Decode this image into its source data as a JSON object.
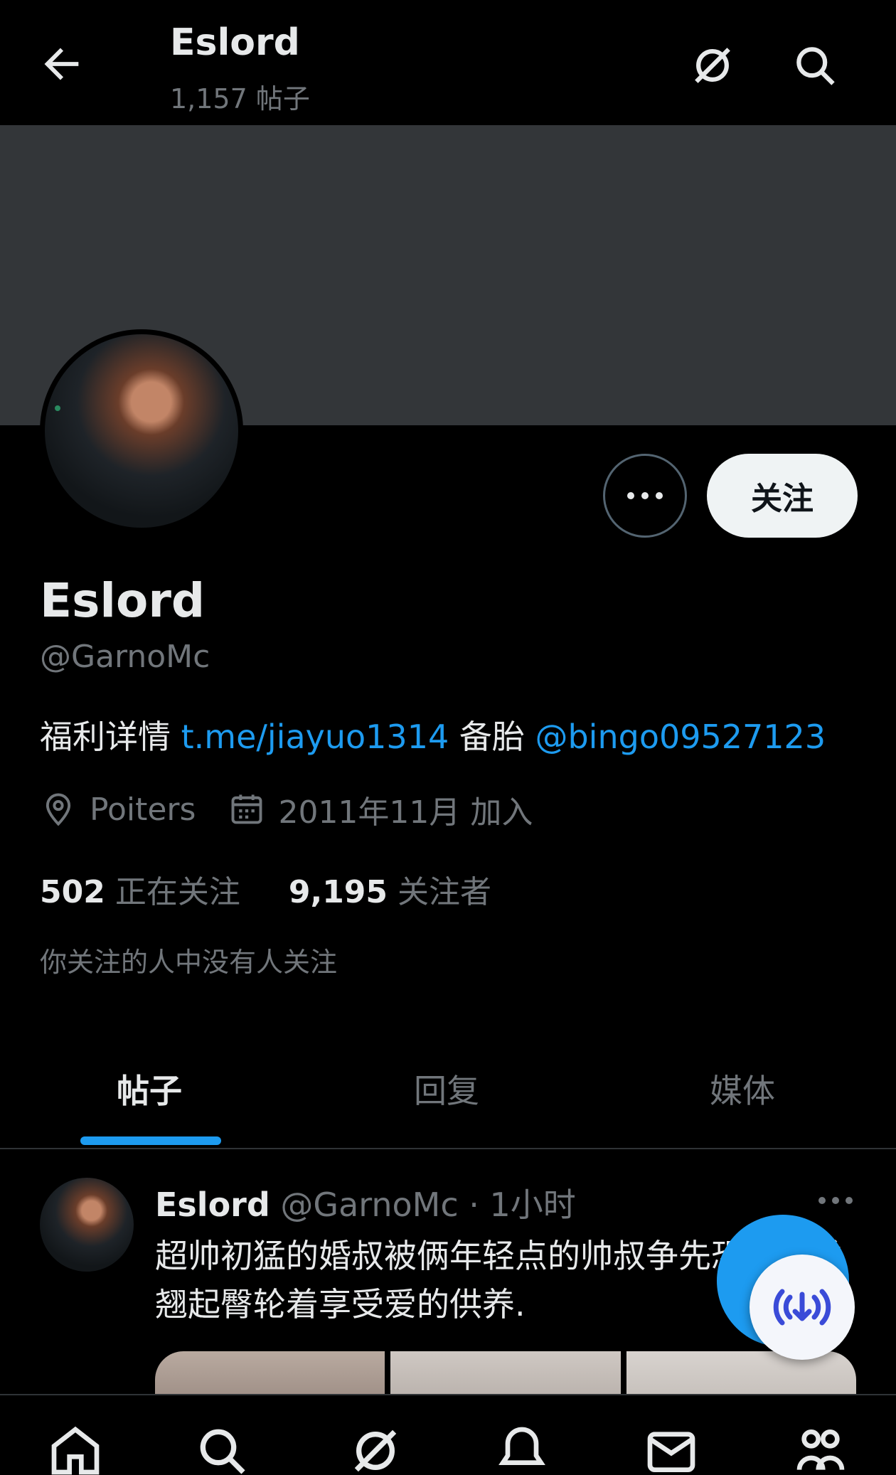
{
  "header": {
    "title": "Eslord",
    "post_count": "1,157 帖子",
    "back_icon": "arrow-left-icon",
    "grok_icon": "grok-icon",
    "search_icon": "search-icon"
  },
  "profile": {
    "name": "Eslord",
    "handle": "@GarnoMc",
    "bio": {
      "text1": "福利详情 ",
      "link1": "t.me/jiayuo1314",
      "text2": " 备胎 ",
      "link2": "@bingo09527123"
    },
    "location": "Poiters",
    "joined": "2011年11月 加入",
    "following_count": "502",
    "following_label": "正在关注",
    "followers_count": "9,195",
    "followers_label": "关注者",
    "social_context": "你关注的人中没有人关注",
    "follow_button": "关注"
  },
  "tabs": [
    {
      "label": "帖子",
      "active": true
    },
    {
      "label": "回复",
      "active": false
    },
    {
      "label": "媒体",
      "active": false
    }
  ],
  "post": {
    "name": "Eslord",
    "handle": "@GarnoMc",
    "time": "· 1小时",
    "text": "超帅初猛的婚叔被俩年轻点的帅叔争先恐后乖乖翘起臀轮着享受爱的供养."
  },
  "nav": [
    "home-icon",
    "search-icon",
    "grok-icon",
    "notifications-icon",
    "messages-icon",
    "communities-icon"
  ],
  "colors": {
    "accent": "#1d9bf0",
    "background": "#000000",
    "banner": "#333639",
    "secondary_text": "#71767b"
  }
}
